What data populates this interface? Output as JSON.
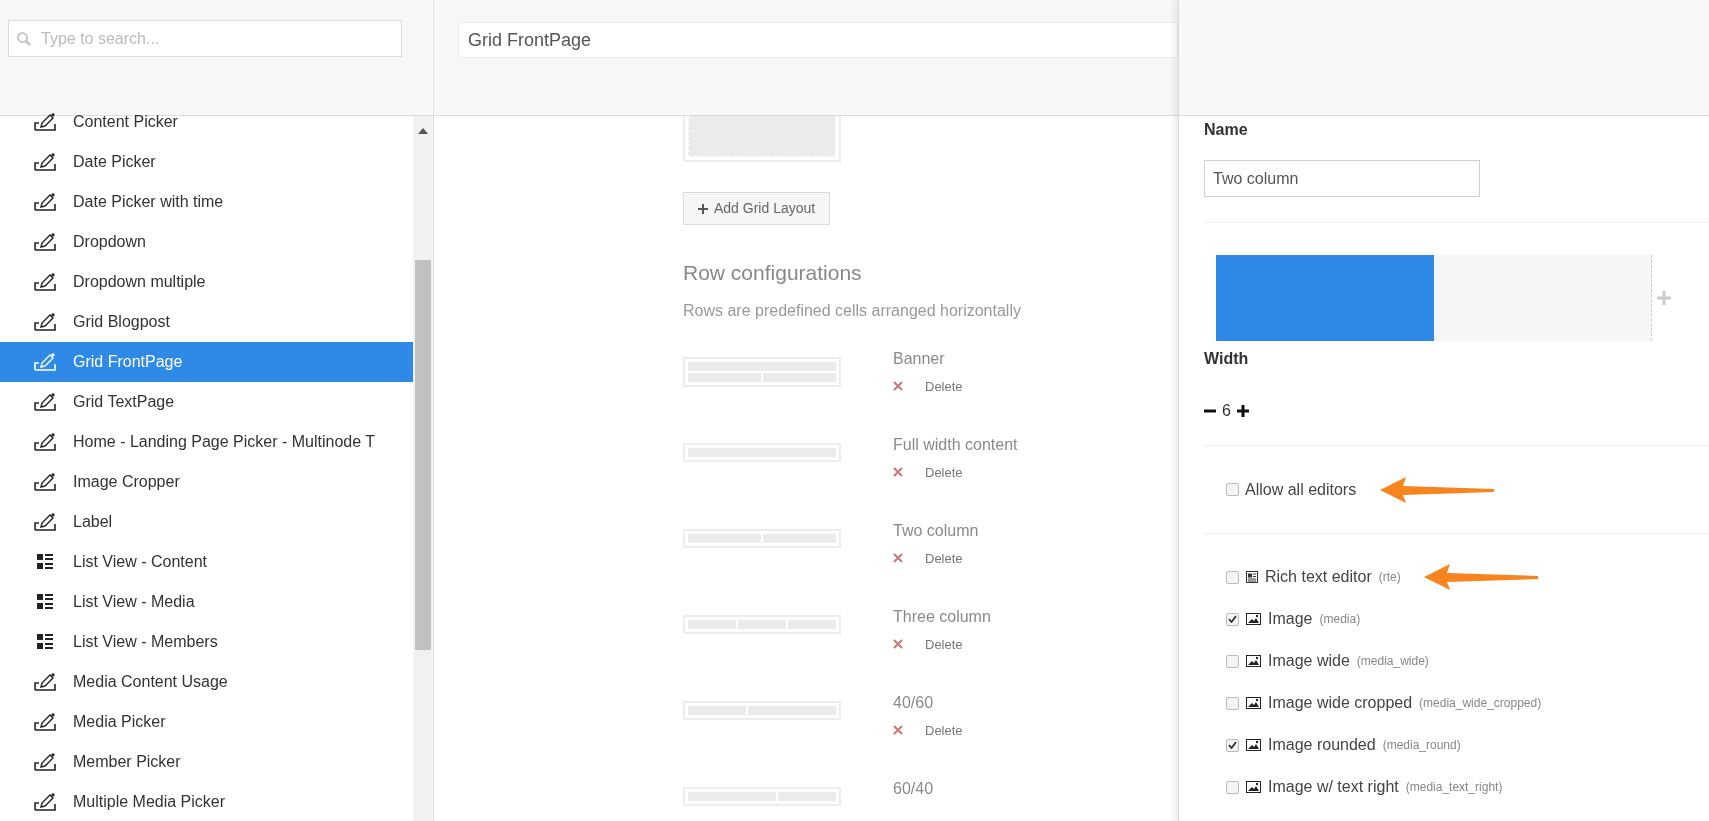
{
  "sidebar": {
    "search": {
      "placeholder": "Type to search..."
    },
    "items": [
      {
        "label": "Content Picker",
        "kind": "edit",
        "selected": false
      },
      {
        "label": "Date Picker",
        "kind": "edit",
        "selected": false
      },
      {
        "label": "Date Picker with time",
        "kind": "edit",
        "selected": false
      },
      {
        "label": "Dropdown",
        "kind": "edit",
        "selected": false
      },
      {
        "label": "Dropdown multiple",
        "kind": "edit",
        "selected": false
      },
      {
        "label": "Grid Blogpost",
        "kind": "edit",
        "selected": false
      },
      {
        "label": "Grid FrontPage",
        "kind": "edit",
        "selected": true
      },
      {
        "label": "Grid TextPage",
        "kind": "edit",
        "selected": false
      },
      {
        "label": "Home - Landing Page Picker - Multinode T",
        "kind": "edit",
        "selected": false
      },
      {
        "label": "Image Cropper",
        "kind": "edit",
        "selected": false
      },
      {
        "label": "Label",
        "kind": "edit",
        "selected": false
      },
      {
        "label": "List View - Content",
        "kind": "list",
        "selected": false
      },
      {
        "label": "List View - Media",
        "kind": "list",
        "selected": false
      },
      {
        "label": "List View - Members",
        "kind": "list",
        "selected": false
      },
      {
        "label": "Media Content Usage",
        "kind": "edit",
        "selected": false
      },
      {
        "label": "Media Picker",
        "kind": "edit",
        "selected": false
      },
      {
        "label": "Member Picker",
        "kind": "edit",
        "selected": false
      },
      {
        "label": "Multiple Media Picker",
        "kind": "edit",
        "selected": false
      }
    ]
  },
  "editor": {
    "title": "Grid FrontPage",
    "add_layout_button": "Add Grid Layout",
    "rows_heading": "Row configurations",
    "rows_description": "Rows are predefined cells arranged horizontally",
    "rows": [
      {
        "name": "Banner",
        "kind": "banner",
        "delete": "Delete"
      },
      {
        "name": "Full width content",
        "kind": "full",
        "delete": "Delete"
      },
      {
        "name": "Two column",
        "kind": "two",
        "delete": "Delete"
      },
      {
        "name": "Three column",
        "kind": "three",
        "delete": "Delete"
      },
      {
        "name": "40/60",
        "kind": "forty-sixty",
        "delete": "Delete"
      },
      {
        "name": "60/40",
        "kind": "sixty-forty"
      }
    ]
  },
  "row_panel": {
    "name_label": "Name",
    "name_value": "Two column",
    "cell": {
      "level": 0.5
    },
    "width_label": "Width",
    "width_value": "6",
    "allow_all": {
      "label": "Allow all editors",
      "checked": false,
      "arrow": true
    },
    "editors": [
      {
        "label": "Rich text editor",
        "alias": "(rte)",
        "kind": "text",
        "checked": false,
        "arrow": true
      },
      {
        "label": "Image",
        "alias": "(media)",
        "kind": "image",
        "checked": true,
        "arrow": false
      },
      {
        "label": "Image wide",
        "alias": "(media_wide)",
        "kind": "image",
        "checked": false,
        "arrow": false
      },
      {
        "label": "Image wide cropped",
        "alias": "(media_wide_cropped)",
        "kind": "image",
        "checked": false,
        "arrow": false
      },
      {
        "label": "Image rounded",
        "alias": "(media_round)",
        "kind": "image",
        "checked": true,
        "arrow": false
      },
      {
        "label": "Image w/ text right",
        "alias": "(media_text_right)",
        "kind": "image",
        "checked": false,
        "arrow": false
      }
    ]
  }
}
